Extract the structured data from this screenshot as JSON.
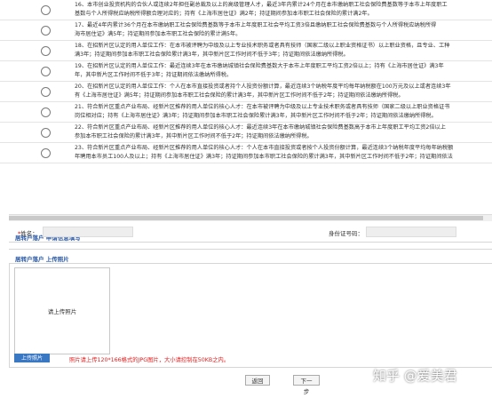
{
  "options": [
    {
      "line1": "16、本市创业投资机构的合伙人或连续2年担任副总裁及以上的高级管理人才，最近3年内累计24个月在本市缴纳职工社会保险费基数等于本市上年度职工",
      "line2": "基数与个人所得税应纳税所得额合理对应的；持有《上海市居住证》满2年；持证期间参加本市职工社会保险的累计满2年。"
    },
    {
      "line1": "17、最近4年内累计36个月在本市缴纳职工社会保险费基数等于本市上年度职工社会平均工资3倍且缴纳职工社会保险费基数与个人所得税应纳税所得",
      "line2": "海市居住证》满5年；持证期间参加本市职工社会保险的累计满5年。"
    },
    {
      "line1": "18、在招新片区认定的用人单位工作：在本市被评聘为中级及以上专业技术职务或者具有技师（国家二级以上职业资格证书）以上职业资格，且专业、工种",
      "line2": "满3年；持证期间参加本市职工社会保险累计满3年，其中新片区工作时间不低于3年；持证期间依法缴纳所得税。"
    },
    {
      "line1": "19、在招新片区认定的用人单位工作：最近连续3年在本市缴纳城镇社会保险费基数大于本市上年度职工平均工资2倍以上；持有《上海市居住证》满3年",
      "line2": "年，其中新片区工作时间不低于3年；持证期间依法缴纳所得税。"
    },
    {
      "line1": "20、在招新片区认定的用人单位工作：个人在本市直接投资或者持个人投资份额计算，最近连续3个纳税年度平均每年纳税额在100万元及以上或者连续3年",
      "line2": "有《上海市居住证》满5年；持证期间参加本市职工社会保险的累计满3年，其中新片区工作时间不低于2年；持证期间依法缴纳所得税。"
    },
    {
      "line1": "21、符合新片区重点产业布局、经新片区推荐的用人单位的核心人才：在本市被评聘为中级及以上专业技术职务或者具有技师（国家二级以上职业资格证书",
      "line2": "岗位相对应；持有《上海市居住证》满3年；持证期间参加本市职工社会保险累计满3年，其中新片区工作时间不低于2年；持证期间依法缴纳所得税。"
    },
    {
      "line1": "22、符合新片区重点产业布局、经新片区推荐的用人单位的核心人才：最近连续3年在本市缴纳城镇社会保险费基数高于本市上年度职工平均工资2倍以上",
      "line2": "参加本市职工社会保险的累计满3年，其中新片区工作时间不低于2年；持证期间依法缴纳所得税。"
    },
    {
      "line1": "23、符合新片区重点产业布局、经新片区推荐的用人单位的核心人才：个人在本市直接投资或者按个人投资份额计算，最近连续3个纳税年度平均每年纳税额",
      "line2": "年聘用本市员工100人及以上；持有《上海市居住证》满3年；持证期间参加本市职工社会保险的累计满3年，其中新片区工作时间不低于2年；持证期间依法"
    }
  ],
  "applicant_section": {
    "title": "居转户落户 申请信息填写"
  },
  "fields": {
    "name_label": "姓名：",
    "name_required": "*",
    "id_label": "身份证号码："
  },
  "photo_section": {
    "title": "居转户落户 上传照片",
    "placeholder": "请上传照片",
    "upload_button": "上传照片",
    "hint": "照片请上传120*166格式的JPG图片，大小请控制在50KB之内。"
  },
  "buttons": {
    "back": "返回",
    "next": "下一步"
  },
  "watermark": "知乎 @爱美君"
}
